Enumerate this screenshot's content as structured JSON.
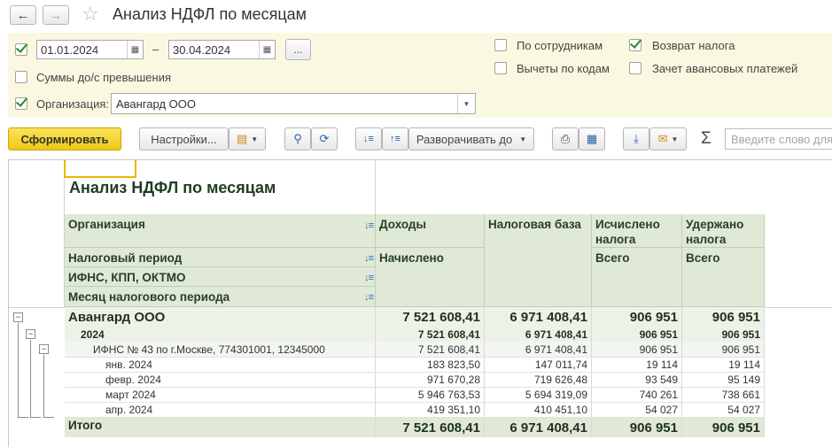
{
  "window": {
    "title": "Анализ НДФЛ по месяцам",
    "back_icon": "arrow-left-icon",
    "forward_icon": "arrow-right-icon",
    "favorite_icon": "star-icon"
  },
  "filters": {
    "period_enabled": true,
    "date_from": "01.01.2024",
    "date_separator": "–",
    "date_to": "30.04.2024",
    "period_button": "...",
    "sums_over_limit_label": "Суммы до/с превышения",
    "sums_over_limit": false,
    "organization_enabled": true,
    "organization_label": "Организация:",
    "organization_value": "Авангард ООО",
    "by_employees_label": "По сотрудникам",
    "by_employees": false,
    "deductions_by_codes_label": "Вычеты по кодам",
    "deductions_by_codes": false,
    "tax_refund_label": "Возврат налога",
    "tax_refund": true,
    "advance_offset_label": "Зачет авансовых платежей",
    "advance_offset": false
  },
  "toolbar": {
    "generate_label": "Сформировать",
    "settings_label": "Настройки...",
    "expand_label": "Разворачивать до",
    "search_placeholder": "Введите слово для поиска",
    "sum_symbol": "Σ",
    "accent_color": "#f0c713"
  },
  "report": {
    "title": "Анализ НДФЛ по месяцам",
    "headers": {
      "organization": "Организация",
      "tax_period": "Налоговый период",
      "ifns": "ИФНС, КПП, ОКТМО",
      "month": "Месяц налогового периода",
      "income": "Доходы",
      "income_sub": "Начислено",
      "tax_base": "Налоговая база",
      "calculated": "Исчислено налога",
      "calculated_sub": "Всего",
      "withheld": "Удержано налога",
      "withheld_sub": "Всего"
    },
    "rows": [
      {
        "label": "Авангард ООО",
        "income": "7 521 608,41",
        "base": "6 971 408,41",
        "calc": "906 951",
        "withheld": "906 951"
      },
      {
        "label": "2024",
        "income": "7 521 608,41",
        "base": "6 971 408,41",
        "calc": "906 951",
        "withheld": "906 951"
      },
      {
        "label": "ИФНС № 43 по г.Москве, 774301001, 12345000",
        "income": "7 521 608,41",
        "base": "6 971 408,41",
        "calc": "906 951",
        "withheld": "906 951"
      },
      {
        "label": "янв. 2024",
        "income": "183 823,50",
        "base": "147 011,74",
        "calc": "19 114",
        "withheld": "19 114"
      },
      {
        "label": "февр. 2024",
        "income": "971 670,28",
        "base": "719 626,48",
        "calc": "93 549",
        "withheld": "95 149"
      },
      {
        "label": "март 2024",
        "income": "5 946 763,53",
        "base": "5 694 319,09",
        "calc": "740 261",
        "withheld": "738 661"
      },
      {
        "label": "апр. 2024",
        "income": "419 351,10",
        "base": "410 451,10",
        "calc": "54 027",
        "withheld": "54 027"
      }
    ],
    "total": {
      "label": "Итого",
      "income": "7 521 608,41",
      "base": "6 971 408,41",
      "calc": "906 951",
      "withheld": "906 951"
    }
  }
}
